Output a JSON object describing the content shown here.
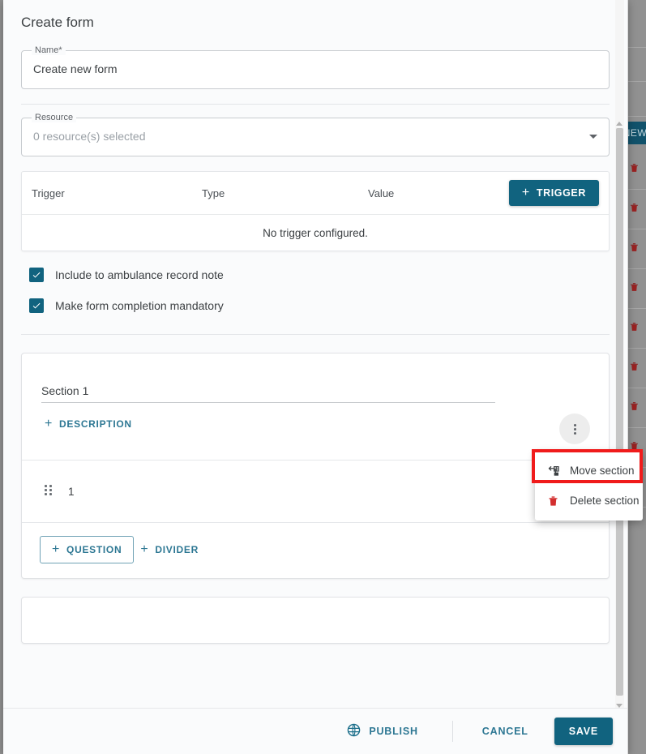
{
  "modal": {
    "title": "Create form",
    "name_field": {
      "label": "Name*",
      "value": "Create new form"
    },
    "resource_field": {
      "label": "Resource",
      "placeholder": "0 resource(s) selected"
    },
    "trigger_table": {
      "columns": [
        "Trigger",
        "Type",
        "Value"
      ],
      "add_button": "TRIGGER",
      "add_button_icon": "plus-icon",
      "empty_message": "No trigger configured."
    },
    "checkboxes": [
      {
        "label": "Include to ambulance record note",
        "checked": true
      },
      {
        "label": "Make form completion mandatory",
        "checked": true
      }
    ],
    "section": {
      "title": "Section 1",
      "description_button": "DESCRIPTION",
      "question_number": "1",
      "add_question_button": "QUESTION",
      "add_divider_button": "DIVIDER",
      "kebab_icon": "more-vertical-icon",
      "drag_handle_icon": "drag-handle-icon"
    },
    "context_menu": {
      "items": [
        {
          "label": "Move section",
          "icon": "move-section-icon",
          "highlighted": true
        },
        {
          "label": "Delete section",
          "icon": "trash-icon",
          "highlighted": false
        }
      ]
    },
    "footer": {
      "publish_label": "PUBLISH",
      "publish_icon": "globe-icon",
      "cancel_label": "CANCEL",
      "save_label": "SAVE"
    }
  },
  "background": {
    "new_button_label": "NEW",
    "row_icon": "trash-icon",
    "row_count": 9
  },
  "colors": {
    "accent": "#11637f",
    "link": "#2d7793",
    "highlight": "#f01b1b",
    "danger": "#c62828",
    "overlay": "#919191"
  }
}
